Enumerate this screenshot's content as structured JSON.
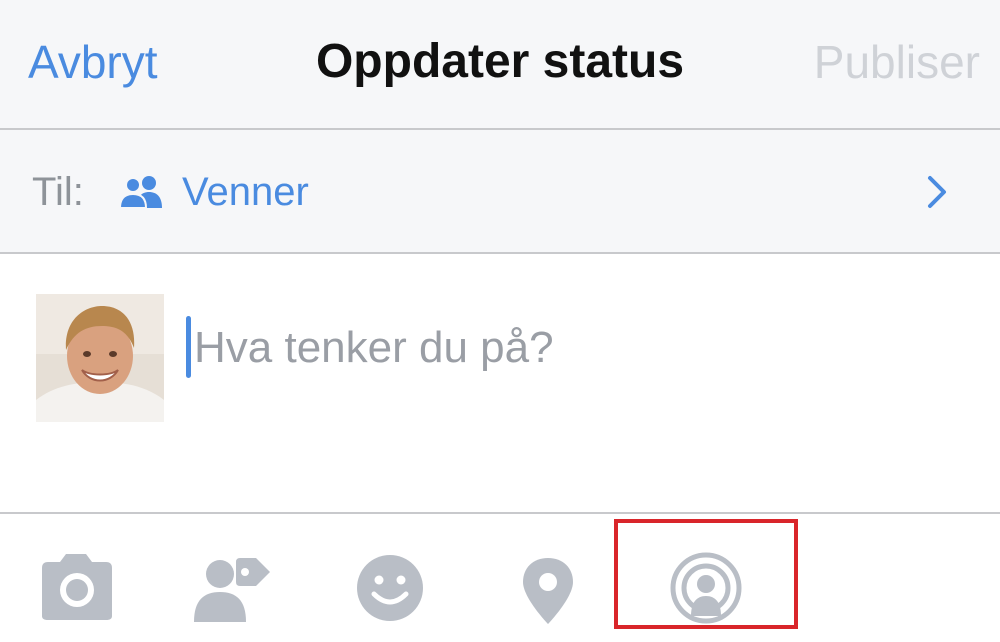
{
  "navbar": {
    "cancel_label": "Avbryt",
    "title": "Oppdater status",
    "publish_label": "Publiser"
  },
  "audience": {
    "label": "Til:",
    "icon": "friends-icon",
    "value": "Venner",
    "chevron_icon": "chevron-right-icon"
  },
  "composer": {
    "placeholder": "Hva tenker du på?",
    "value": ""
  },
  "toolbar": {
    "items": [
      "camera-icon",
      "tag-people-icon",
      "emoji-icon",
      "location-pin-icon",
      "live-broadcast-icon"
    ]
  },
  "colors": {
    "accent": "#4a8be0",
    "icon_gray": "#b9bec6",
    "highlight": "#d9252a",
    "disabled_text": "#cfd2d7"
  }
}
